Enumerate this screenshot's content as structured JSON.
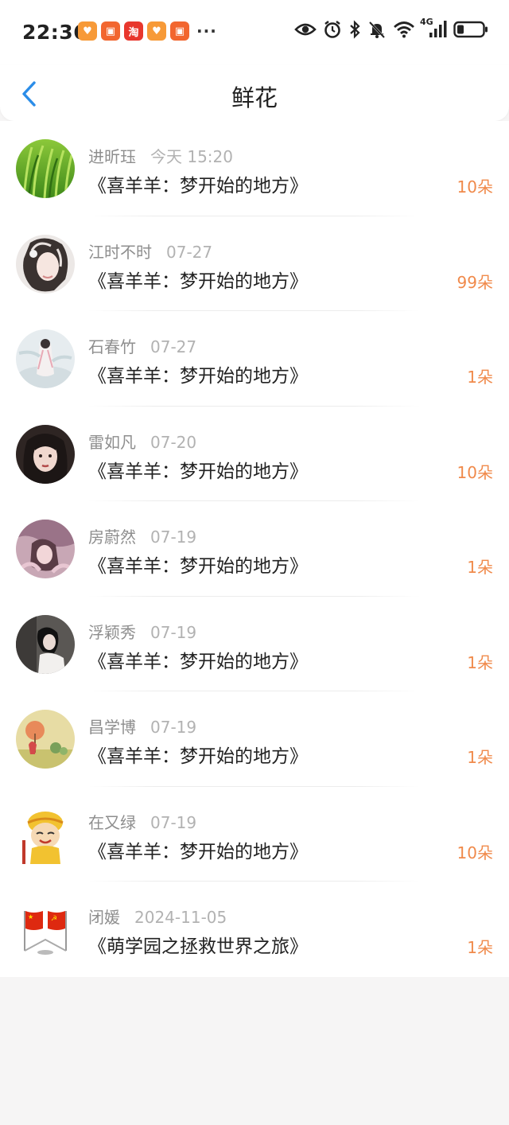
{
  "status": {
    "time": "22:36",
    "more": "···",
    "network": "4G",
    "app_icons": [
      {
        "name": "app-icon-heart",
        "glyph": "♥",
        "color": "#f79a38"
      },
      {
        "name": "app-icon-chat",
        "glyph": "▣",
        "color": "#f2662f"
      },
      {
        "name": "app-icon-taobao",
        "glyph": "淘",
        "color": "#e8372d"
      },
      {
        "name": "app-icon-heart-2",
        "glyph": "♥",
        "color": "#f79a38"
      },
      {
        "name": "app-icon-chat-2",
        "glyph": "▣",
        "color": "#f2662f"
      }
    ]
  },
  "nav": {
    "title": "鲜花",
    "back_icon": "chevron-left-icon",
    "accent": "#2b8de8"
  },
  "colors": {
    "count": "#f08a4b"
  },
  "items": [
    {
      "name": "进昕珏",
      "time": "今天 15:20",
      "title": "《喜羊羊：梦开始的地方》",
      "count": "10朵"
    },
    {
      "name": "江时不时",
      "time": "07-27",
      "title": "《喜羊羊：梦开始的地方》",
      "count": "99朵"
    },
    {
      "name": "石春竹",
      "time": "07-27",
      "title": "《喜羊羊：梦开始的地方》",
      "count": "1朵"
    },
    {
      "name": "雷如凡",
      "time": "07-20",
      "title": "《喜羊羊：梦开始的地方》",
      "count": "10朵"
    },
    {
      "name": "房蔚然",
      "time": "07-19",
      "title": "《喜羊羊：梦开始的地方》",
      "count": "1朵"
    },
    {
      "name": "浮颖秀",
      "time": "07-19",
      "title": "《喜羊羊：梦开始的地方》",
      "count": "1朵"
    },
    {
      "name": "昌学博",
      "time": "07-19",
      "title": "《喜羊羊：梦开始的地方》",
      "count": "1朵"
    },
    {
      "name": "在又绿",
      "time": "07-19",
      "title": "《喜羊羊：梦开始的地方》",
      "count": "10朵"
    },
    {
      "name": "闭媛",
      "time": "2024-11-05",
      "title": "《萌学园之拯救世界之旅》",
      "count": "1朵"
    }
  ]
}
